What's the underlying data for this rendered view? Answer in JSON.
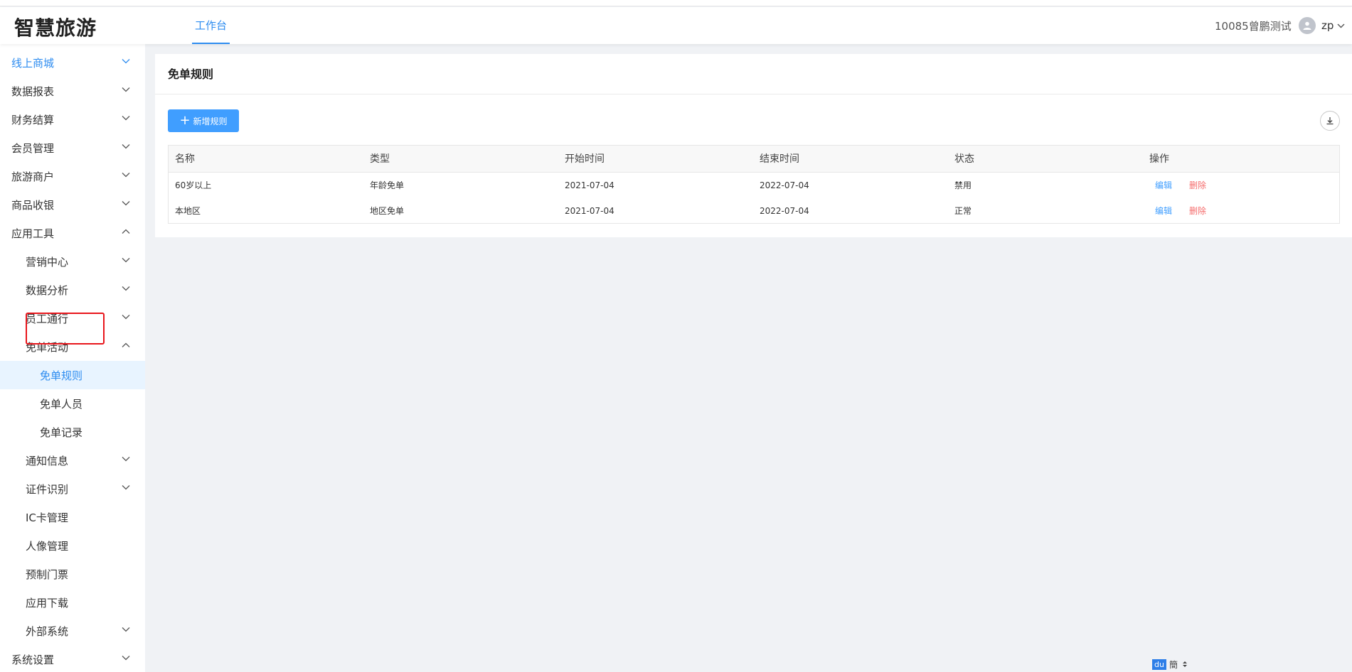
{
  "app": {
    "logo": "智慧旅游",
    "nav_tab": "工作台",
    "org_name": "10085曾鹏测试",
    "user_name": "zp"
  },
  "sidebar": {
    "items": [
      {
        "label": "线上商城",
        "chevron": "down",
        "state": "active-parent"
      },
      {
        "label": "数据报表",
        "chevron": "down"
      },
      {
        "label": "财务结算",
        "chevron": "down"
      },
      {
        "label": "会员管理",
        "chevron": "down"
      },
      {
        "label": "旅游商户",
        "chevron": "down"
      },
      {
        "label": "商品收银",
        "chevron": "down"
      },
      {
        "label": "应用工具",
        "chevron": "up"
      },
      {
        "label": "营销中心",
        "chevron": "down",
        "level": 2
      },
      {
        "label": "数据分析",
        "chevron": "down",
        "level": 2
      },
      {
        "label": "员工通行",
        "chevron": "down",
        "level": 2
      },
      {
        "label": "免单活动",
        "chevron": "up",
        "level": 2
      },
      {
        "label": "免单规则",
        "level": 3,
        "state": "selected"
      },
      {
        "label": "免单人员",
        "level": 3
      },
      {
        "label": "免单记录",
        "level": 3
      },
      {
        "label": "通知信息",
        "chevron": "down",
        "level": 2
      },
      {
        "label": "证件识别",
        "chevron": "down",
        "level": 2
      },
      {
        "label": "IC卡管理",
        "level": 2
      },
      {
        "label": "人像管理",
        "level": 2
      },
      {
        "label": "预制门票",
        "level": 2
      },
      {
        "label": "应用下载",
        "level": 2
      },
      {
        "label": "外部系统",
        "chevron": "down",
        "level": 2
      },
      {
        "label": "系统设置",
        "chevron": "down"
      }
    ]
  },
  "main": {
    "title": "免单规则",
    "add_button": "新增规则",
    "table": {
      "headers": [
        "名称",
        "类型",
        "开始时间",
        "结束时间",
        "状态",
        "操作"
      ],
      "rows": [
        {
          "name": "60岁以上",
          "type": "年龄免单",
          "start": "2021-07-04",
          "end": "2022-07-04",
          "status": "禁用",
          "edit": "编辑",
          "delete": "删除"
        },
        {
          "name": "本地区",
          "type": "地区免单",
          "start": "2021-07-04",
          "end": "2022-07-04",
          "status": "正常",
          "edit": "编辑",
          "delete": "删除"
        }
      ]
    }
  },
  "widget": {
    "badge": "du",
    "text": "簡"
  },
  "colors": {
    "accent": "#2d8cf0",
    "primary_button": "#409eff",
    "danger": "#f56c6c",
    "selection_outline": "#e8151b",
    "selected_bg": "#e8f4ff"
  },
  "icons": {
    "user": "user-avatar-icon",
    "chevron_down": "chevron-down-icon",
    "chevron_up": "chevron-up-icon",
    "plus": "plus-icon",
    "download": "download-icon"
  }
}
